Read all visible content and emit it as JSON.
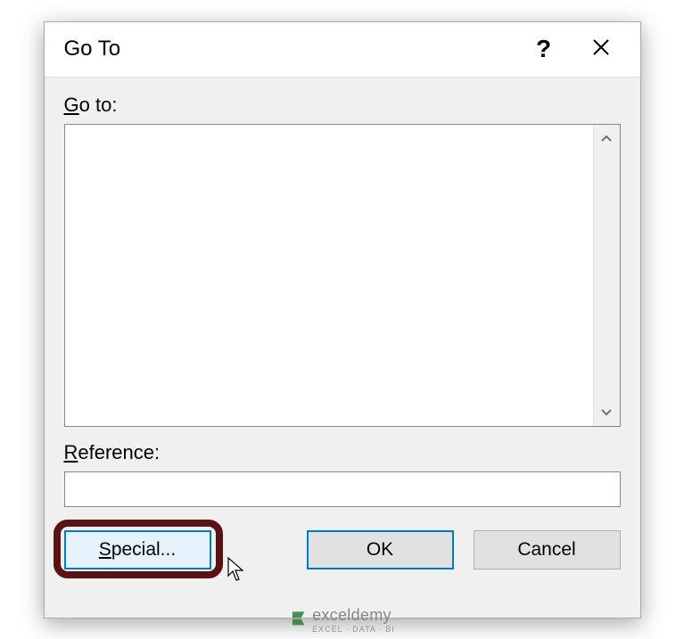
{
  "dialog": {
    "title": "Go To",
    "help_tooltip": "?",
    "close_tooltip": "Close"
  },
  "labels": {
    "goto": "Go to:",
    "reference": "Reference:"
  },
  "inputs": {
    "reference_value": ""
  },
  "buttons": {
    "special": "Special...",
    "ok": "OK",
    "cancel": "Cancel"
  },
  "watermark": {
    "brand": "exceldemy",
    "tagline": "EXCEL · DATA · BI"
  }
}
